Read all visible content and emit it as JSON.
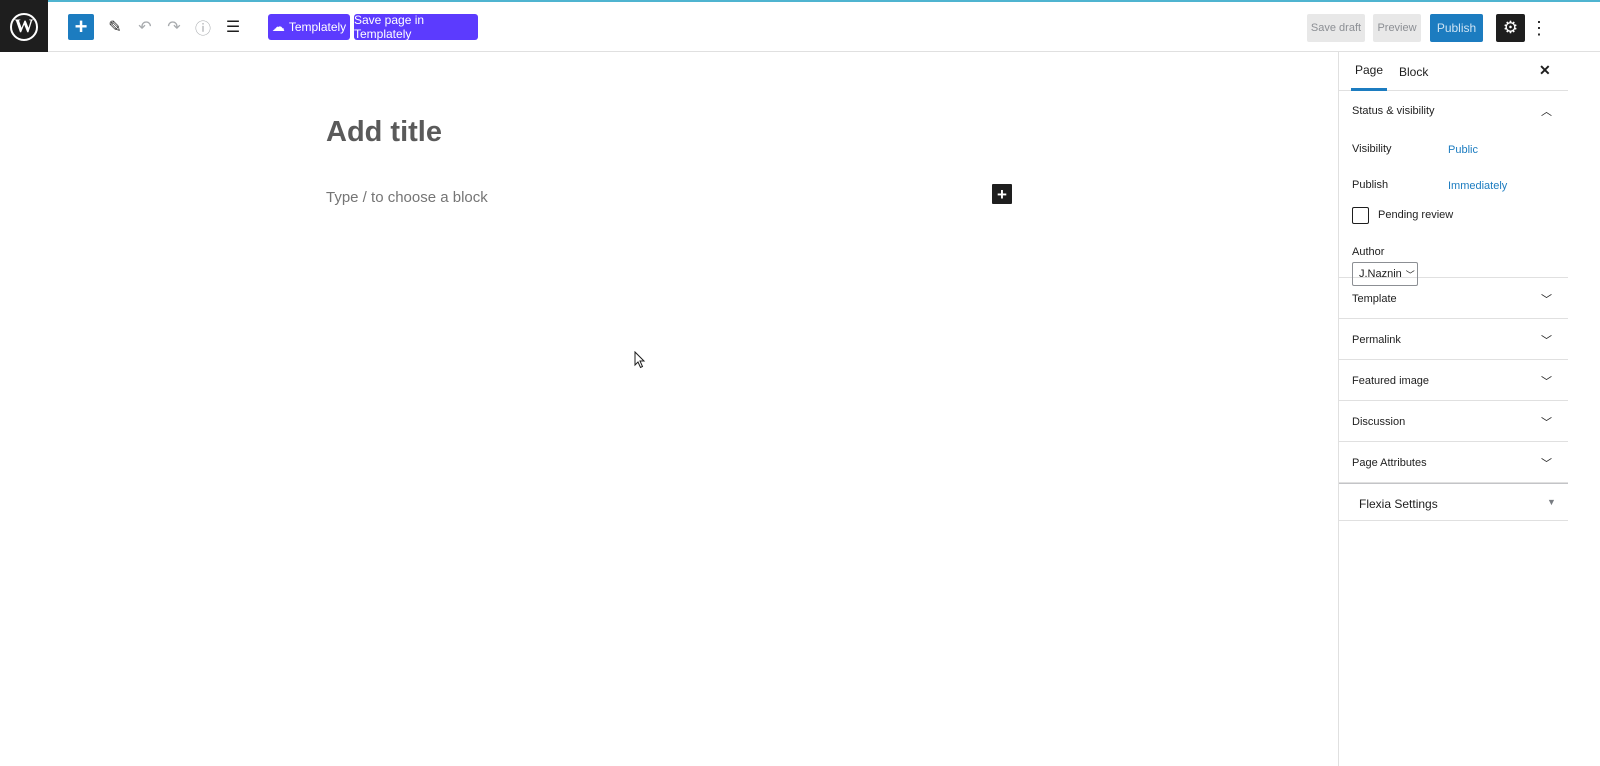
{
  "toolbar": {
    "logo": "W",
    "add_icon": "+",
    "templately_label": "Templately",
    "save_templately_label": "Save page in Templately",
    "save_draft_label": "Save draft",
    "preview_label": "Preview",
    "publish_label": "Publish",
    "settings_icon": "⚙",
    "more_icon": "⋮",
    "edit_icon": "✎",
    "undo_icon": "↶",
    "redo_icon": "↷",
    "info_icon": "ⓘ",
    "outline_icon": "☰"
  },
  "editor": {
    "title_placeholder": "Add title",
    "block_placeholder": "Type / to choose a block",
    "inline_add_icon": "+"
  },
  "sidebar": {
    "tabs": [
      {
        "label": "Page"
      },
      {
        "label": "Block"
      }
    ],
    "close_icon": "✕",
    "status": {
      "title": "Status & visibility",
      "visibility_label": "Visibility",
      "visibility_value": "Public",
      "publish_label": "Publish",
      "publish_value": "Immediately",
      "pending_label": "Pending review",
      "author_label": "Author",
      "author_value": "J.Naznin"
    },
    "panels": [
      {
        "label": "Template"
      },
      {
        "label": "Permalink"
      },
      {
        "label": "Featured image"
      },
      {
        "label": "Discussion"
      },
      {
        "label": "Page Attributes"
      }
    ],
    "flexia_label": "Flexia Settings"
  },
  "colors": {
    "accent": "#1c7cc0",
    "templately": "#5c3bfe",
    "dark": "#1e1e1e"
  }
}
